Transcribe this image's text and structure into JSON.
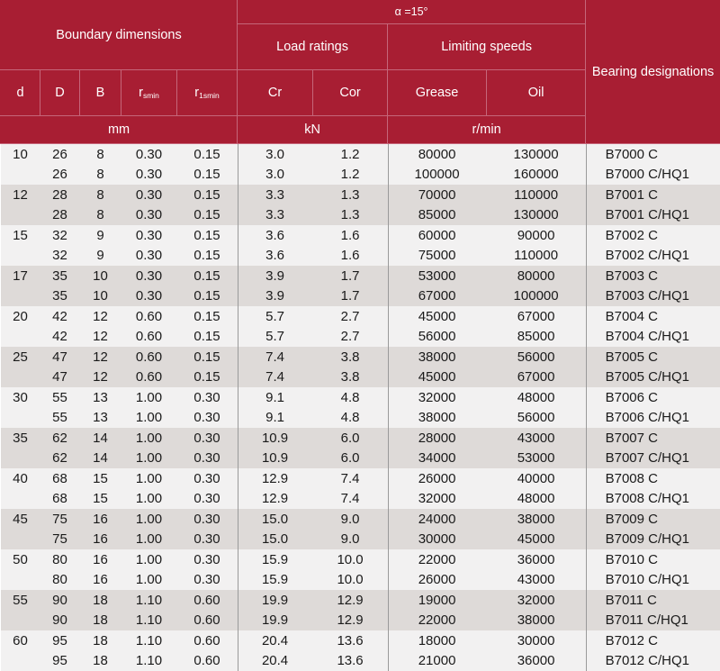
{
  "table": {
    "header": {
      "alpha_label": "α =15°",
      "boundary_dimensions": "Boundary dimensions",
      "load_ratings": "Load ratings",
      "limiting_speeds": "Limiting speeds",
      "bearing_designations": "Bearing designations",
      "sub_labels": {
        "d": "d",
        "D": "D",
        "B": "B",
        "rsmin_base": "r",
        "rsmin_sub": "smin",
        "r1smin_base": "r",
        "r1smin_sub": "1smin",
        "Cr": "Cr",
        "Cor": "Cor",
        "Grease": "Grease",
        "Oil": "Oil"
      },
      "units": {
        "dimensions": "mm",
        "load": "kN",
        "speed": "r/min"
      }
    },
    "colors": {
      "header_bg": "#A81E33",
      "header_text": "#FFFFFF",
      "header_rule": "#C5667A",
      "row_light": "#F2F1F1",
      "row_dark": "#DEDAD8",
      "separator": "#9A9A9A",
      "body_text": "#1A1A1A"
    },
    "columns": [
      "d",
      "D",
      "B",
      "rsmin",
      "r1smin",
      "Cr",
      "Cor",
      "Grease",
      "Oil",
      "designation"
    ],
    "rows": [
      {
        "band": "light",
        "d": "10",
        "D": "26",
        "B": "8",
        "rsmin": "0.30",
        "r1smin": "0.15",
        "Cr": "3.0",
        "Cor": "1.2",
        "Grease": "80000",
        "Oil": "130000",
        "designation": "B7000 C"
      },
      {
        "band": "light",
        "d": "",
        "D": "26",
        "B": "8",
        "rsmin": "0.30",
        "r1smin": "0.15",
        "Cr": "3.0",
        "Cor": "1.2",
        "Grease": "100000",
        "Oil": "160000",
        "designation": "B7000  C/HQ1"
      },
      {
        "band": "dark",
        "d": "12",
        "D": "28",
        "B": "8",
        "rsmin": "0.30",
        "r1smin": "0.15",
        "Cr": "3.3",
        "Cor": "1.3",
        "Grease": "70000",
        "Oil": "110000",
        "designation": "B7001 C"
      },
      {
        "band": "dark",
        "d": "",
        "D": "28",
        "B": "8",
        "rsmin": "0.30",
        "r1smin": "0.15",
        "Cr": "3.3",
        "Cor": "1.3",
        "Grease": "85000",
        "Oil": "130000",
        "designation": "B7001  C/HQ1"
      },
      {
        "band": "light",
        "d": "15",
        "D": "32",
        "B": "9",
        "rsmin": "0.30",
        "r1smin": "0.15",
        "Cr": "3.6",
        "Cor": "1.6",
        "Grease": "60000",
        "Oil": "90000",
        "designation": "B7002 C"
      },
      {
        "band": "light",
        "d": "",
        "D": "32",
        "B": "9",
        "rsmin": "0.30",
        "r1smin": "0.15",
        "Cr": "3.6",
        "Cor": "1.6",
        "Grease": "75000",
        "Oil": "110000",
        "designation": "B7002  C/HQ1"
      },
      {
        "band": "dark",
        "d": "17",
        "D": "35",
        "B": "10",
        "rsmin": "0.30",
        "r1smin": "0.15",
        "Cr": "3.9",
        "Cor": "1.7",
        "Grease": "53000",
        "Oil": "80000",
        "designation": "B7003 C"
      },
      {
        "band": "dark",
        "d": "",
        "D": "35",
        "B": "10",
        "rsmin": "0.30",
        "r1smin": "0.15",
        "Cr": "3.9",
        "Cor": "1.7",
        "Grease": "67000",
        "Oil": "100000",
        "designation": "B7003  C/HQ1"
      },
      {
        "band": "light",
        "d": "20",
        "D": "42",
        "B": "12",
        "rsmin": "0.60",
        "r1smin": "0.15",
        "Cr": "5.7",
        "Cor": "2.7",
        "Grease": "45000",
        "Oil": "67000",
        "designation": "B7004 C"
      },
      {
        "band": "light",
        "d": "",
        "D": "42",
        "B": "12",
        "rsmin": "0.60",
        "r1smin": "0.15",
        "Cr": "5.7",
        "Cor": "2.7",
        "Grease": "56000",
        "Oil": "85000",
        "designation": "B7004  C/HQ1"
      },
      {
        "band": "dark",
        "d": "25",
        "D": "47",
        "B": "12",
        "rsmin": "0.60",
        "r1smin": "0.15",
        "Cr": "7.4",
        "Cor": "3.8",
        "Grease": "38000",
        "Oil": "56000",
        "designation": "B7005 C"
      },
      {
        "band": "dark",
        "d": "",
        "D": "47",
        "B": "12",
        "rsmin": "0.60",
        "r1smin": "0.15",
        "Cr": "7.4",
        "Cor": "3.8",
        "Grease": "45000",
        "Oil": "67000",
        "designation": "B7005  C/HQ1"
      },
      {
        "band": "light",
        "d": "30",
        "D": "55",
        "B": "13",
        "rsmin": "1.00",
        "r1smin": "0.30",
        "Cr": "9.1",
        "Cor": "4.8",
        "Grease": "32000",
        "Oil": "48000",
        "designation": "B7006 C"
      },
      {
        "band": "light",
        "d": "",
        "D": "55",
        "B": "13",
        "rsmin": "1.00",
        "r1smin": "0.30",
        "Cr": "9.1",
        "Cor": "4.8",
        "Grease": "38000",
        "Oil": "56000",
        "designation": "B7006  C/HQ1"
      },
      {
        "band": "dark",
        "d": "35",
        "D": "62",
        "B": "14",
        "rsmin": "1.00",
        "r1smin": "0.30",
        "Cr": "10.9",
        "Cor": "6.0",
        "Grease": "28000",
        "Oil": "43000",
        "designation": "B7007 C"
      },
      {
        "band": "dark",
        "d": "",
        "D": "62",
        "B": "14",
        "rsmin": "1.00",
        "r1smin": "0.30",
        "Cr": "10.9",
        "Cor": "6.0",
        "Grease": "34000",
        "Oil": "53000",
        "designation": "B7007  C/HQ1"
      },
      {
        "band": "light",
        "d": "40",
        "D": "68",
        "B": "15",
        "rsmin": "1.00",
        "r1smin": "0.30",
        "Cr": "12.9",
        "Cor": "7.4",
        "Grease": "26000",
        "Oil": "40000",
        "designation": "B7008 C"
      },
      {
        "band": "light",
        "d": "",
        "D": "68",
        "B": "15",
        "rsmin": "1.00",
        "r1smin": "0.30",
        "Cr": "12.9",
        "Cor": "7.4",
        "Grease": "32000",
        "Oil": "48000",
        "designation": "B7008  C/HQ1"
      },
      {
        "band": "dark",
        "d": "45",
        "D": "75",
        "B": "16",
        "rsmin": "1.00",
        "r1smin": "0.30",
        "Cr": "15.0",
        "Cor": "9.0",
        "Grease": "24000",
        "Oil": "38000",
        "designation": "B7009 C"
      },
      {
        "band": "dark",
        "d": "",
        "D": "75",
        "B": "16",
        "rsmin": "1.00",
        "r1smin": "0.30",
        "Cr": "15.0",
        "Cor": "9.0",
        "Grease": "30000",
        "Oil": "45000",
        "designation": "B7009  C/HQ1"
      },
      {
        "band": "light",
        "d": "50",
        "D": "80",
        "B": "16",
        "rsmin": "1.00",
        "r1smin": "0.30",
        "Cr": "15.9",
        "Cor": "10.0",
        "Grease": "22000",
        "Oil": "36000",
        "designation": "B7010 C"
      },
      {
        "band": "light",
        "d": "",
        "D": "80",
        "B": "16",
        "rsmin": "1.00",
        "r1smin": "0.30",
        "Cr": "15.9",
        "Cor": "10.0",
        "Grease": "26000",
        "Oil": "43000",
        "designation": "B7010  C/HQ1"
      },
      {
        "band": "dark",
        "d": "55",
        "D": "90",
        "B": "18",
        "rsmin": "1.10",
        "r1smin": "0.60",
        "Cr": "19.9",
        "Cor": "12.9",
        "Grease": "19000",
        "Oil": "32000",
        "designation": "B7011 C"
      },
      {
        "band": "dark",
        "d": "",
        "D": "90",
        "B": "18",
        "rsmin": "1.10",
        "r1smin": "0.60",
        "Cr": "19.9",
        "Cor": "12.9",
        "Grease": "22000",
        "Oil": "38000",
        "designation": "B7011  C/HQ1"
      },
      {
        "band": "light",
        "d": "60",
        "D": "95",
        "B": "18",
        "rsmin": "1.10",
        "r1smin": "0.60",
        "Cr": "20.4",
        "Cor": "13.6",
        "Grease": "18000",
        "Oil": "30000",
        "designation": "B7012 C"
      },
      {
        "band": "light",
        "d": "",
        "D": "95",
        "B": "18",
        "rsmin": "1.10",
        "r1smin": "0.60",
        "Cr": "20.4",
        "Cor": "13.6",
        "Grease": "21000",
        "Oil": "36000",
        "designation": "B7012  C/HQ1"
      }
    ]
  }
}
